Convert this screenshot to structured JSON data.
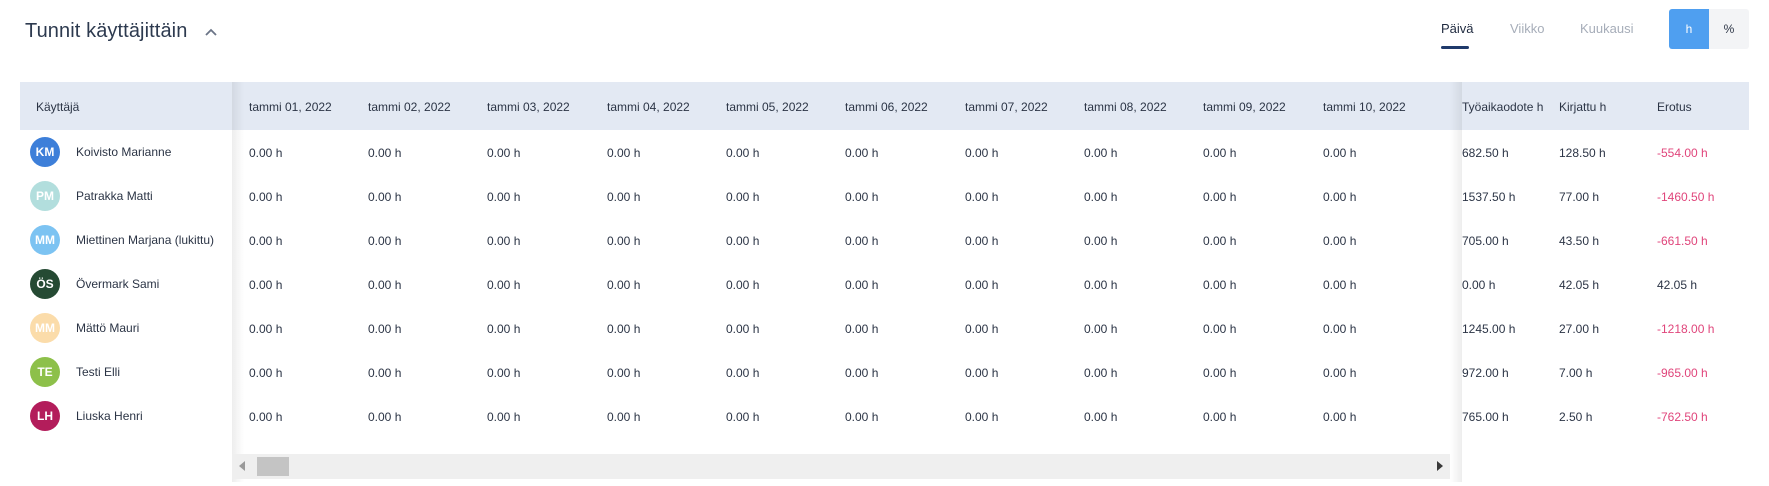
{
  "header": {
    "title": "Tunnit käyttäjittäin",
    "collapse_icon": "chevron-up-icon",
    "tabs": [
      "Päivä",
      "Viikko",
      "Kuukausi"
    ],
    "active_tab": "Päivä",
    "unit_options": [
      "h",
      "%"
    ],
    "active_unit": "h"
  },
  "table": {
    "user_header": "Käyttäjä",
    "date_columns": [
      "tammi 01, 2022",
      "tammi 02, 2022",
      "tammi 03, 2022",
      "tammi 04, 2022",
      "tammi 05, 2022",
      "tammi 06, 2022",
      "tammi 07, 2022",
      "tammi 08, 2022",
      "tammi 09, 2022",
      "tammi 10, 2022"
    ],
    "summary_columns": [
      "Työaikaodote h",
      "Kirjattu h",
      "Erotus"
    ],
    "rows": [
      {
        "initials": "KM",
        "name": "Koivisto Marianne",
        "avatar_color": "#3d7fd9",
        "days": [
          "0.00 h",
          "0.00 h",
          "0.00 h",
          "0.00 h",
          "0.00 h",
          "0.00 h",
          "0.00 h",
          "0.00 h",
          "0.00 h",
          "0.00 h"
        ],
        "expected": "682.50 h",
        "logged": "128.50 h",
        "diff": "-554.00 h",
        "diff_negative": true
      },
      {
        "initials": "PM",
        "name": "Patrakka Matti",
        "avatar_color": "#b2dedd",
        "days": [
          "0.00 h",
          "0.00 h",
          "0.00 h",
          "0.00 h",
          "0.00 h",
          "0.00 h",
          "0.00 h",
          "0.00 h",
          "0.00 h",
          "0.00 h"
        ],
        "expected": "1537.50 h",
        "logged": "77.00 h",
        "diff": "-1460.50 h",
        "diff_negative": true
      },
      {
        "initials": "MM",
        "name": "Miettinen Marjana (lukittu)",
        "avatar_color": "#7cc3f2",
        "days": [
          "0.00 h",
          "0.00 h",
          "0.00 h",
          "0.00 h",
          "0.00 h",
          "0.00 h",
          "0.00 h",
          "0.00 h",
          "0.00 h",
          "0.00 h"
        ],
        "expected": "705.00 h",
        "logged": "43.50 h",
        "diff": "-661.50 h",
        "diff_negative": true
      },
      {
        "initials": "ÖS",
        "name": "Övermark Sami",
        "avatar_color": "#254a33",
        "days": [
          "0.00 h",
          "0.00 h",
          "0.00 h",
          "0.00 h",
          "0.00 h",
          "0.00 h",
          "0.00 h",
          "0.00 h",
          "0.00 h",
          "0.00 h"
        ],
        "expected": "0.00 h",
        "logged": "42.05 h",
        "diff": "42.05 h",
        "diff_negative": false
      },
      {
        "initials": "MM",
        "name": "Mättö Mauri",
        "avatar_color": "#fbdcaa",
        "days": [
          "0.00 h",
          "0.00 h",
          "0.00 h",
          "0.00 h",
          "0.00 h",
          "0.00 h",
          "0.00 h",
          "0.00 h",
          "0.00 h",
          "0.00 h"
        ],
        "expected": "1245.00 h",
        "logged": "27.00 h",
        "diff": "-1218.00 h",
        "diff_negative": true
      },
      {
        "initials": "TE",
        "name": "Testi Elli",
        "avatar_color": "#8dc04a",
        "days": [
          "0.00 h",
          "0.00 h",
          "0.00 h",
          "0.00 h",
          "0.00 h",
          "0.00 h",
          "0.00 h",
          "0.00 h",
          "0.00 h",
          "0.00 h"
        ],
        "expected": "972.00 h",
        "logged": "7.00 h",
        "diff": "-965.00 h",
        "diff_negative": true
      },
      {
        "initials": "LH",
        "name": "Liuska Henri",
        "avatar_color": "#b31d5b",
        "days": [
          "0.00 h",
          "0.00 h",
          "0.00 h",
          "0.00 h",
          "0.00 h",
          "0.00 h",
          "0.00 h",
          "0.00 h",
          "0.00 h",
          "0.00 h"
        ],
        "expected": "765.00 h",
        "logged": "2.50 h",
        "diff": "-762.50 h",
        "diff_negative": true
      }
    ]
  },
  "scrollbar": {
    "left_icon": "arrow-left-icon",
    "right_icon": "arrow-right-icon"
  },
  "colors": {
    "accent": "#4f9ff0",
    "negative": "#e0457b",
    "header_bg": "#e3e9f3"
  }
}
